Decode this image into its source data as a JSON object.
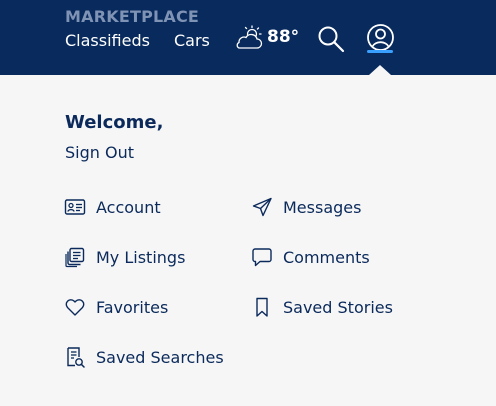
{
  "header": {
    "section_label": "MARKETPLACE",
    "nav": [
      {
        "label": "Classifieds"
      },
      {
        "label": "Cars"
      }
    ],
    "weather": {
      "temperature": "88°",
      "icon": "partly-cloudy-icon"
    },
    "search_icon": "search-icon",
    "account_icon": "user-circle-icon"
  },
  "account_menu": {
    "welcome": "Welcome,",
    "sign_out": "Sign Out",
    "items": [
      {
        "label": "Account",
        "icon": "id-card-icon"
      },
      {
        "label": "Messages",
        "icon": "paper-plane-icon"
      },
      {
        "label": "My Listings",
        "icon": "listings-stack-icon"
      },
      {
        "label": "Comments",
        "icon": "speech-bubble-icon"
      },
      {
        "label": "Favorites",
        "icon": "heart-icon"
      },
      {
        "label": "Saved Stories",
        "icon": "bookmark-icon"
      },
      {
        "label": "Saved Searches",
        "icon": "saved-search-document-icon"
      }
    ]
  },
  "colors": {
    "header_bg": "#082a5c",
    "section_label": "#7f93b5",
    "text_dark_blue": "#0b2a5b",
    "menu_bg": "#f6f6f6",
    "active_underline": "#3aa0ff"
  }
}
